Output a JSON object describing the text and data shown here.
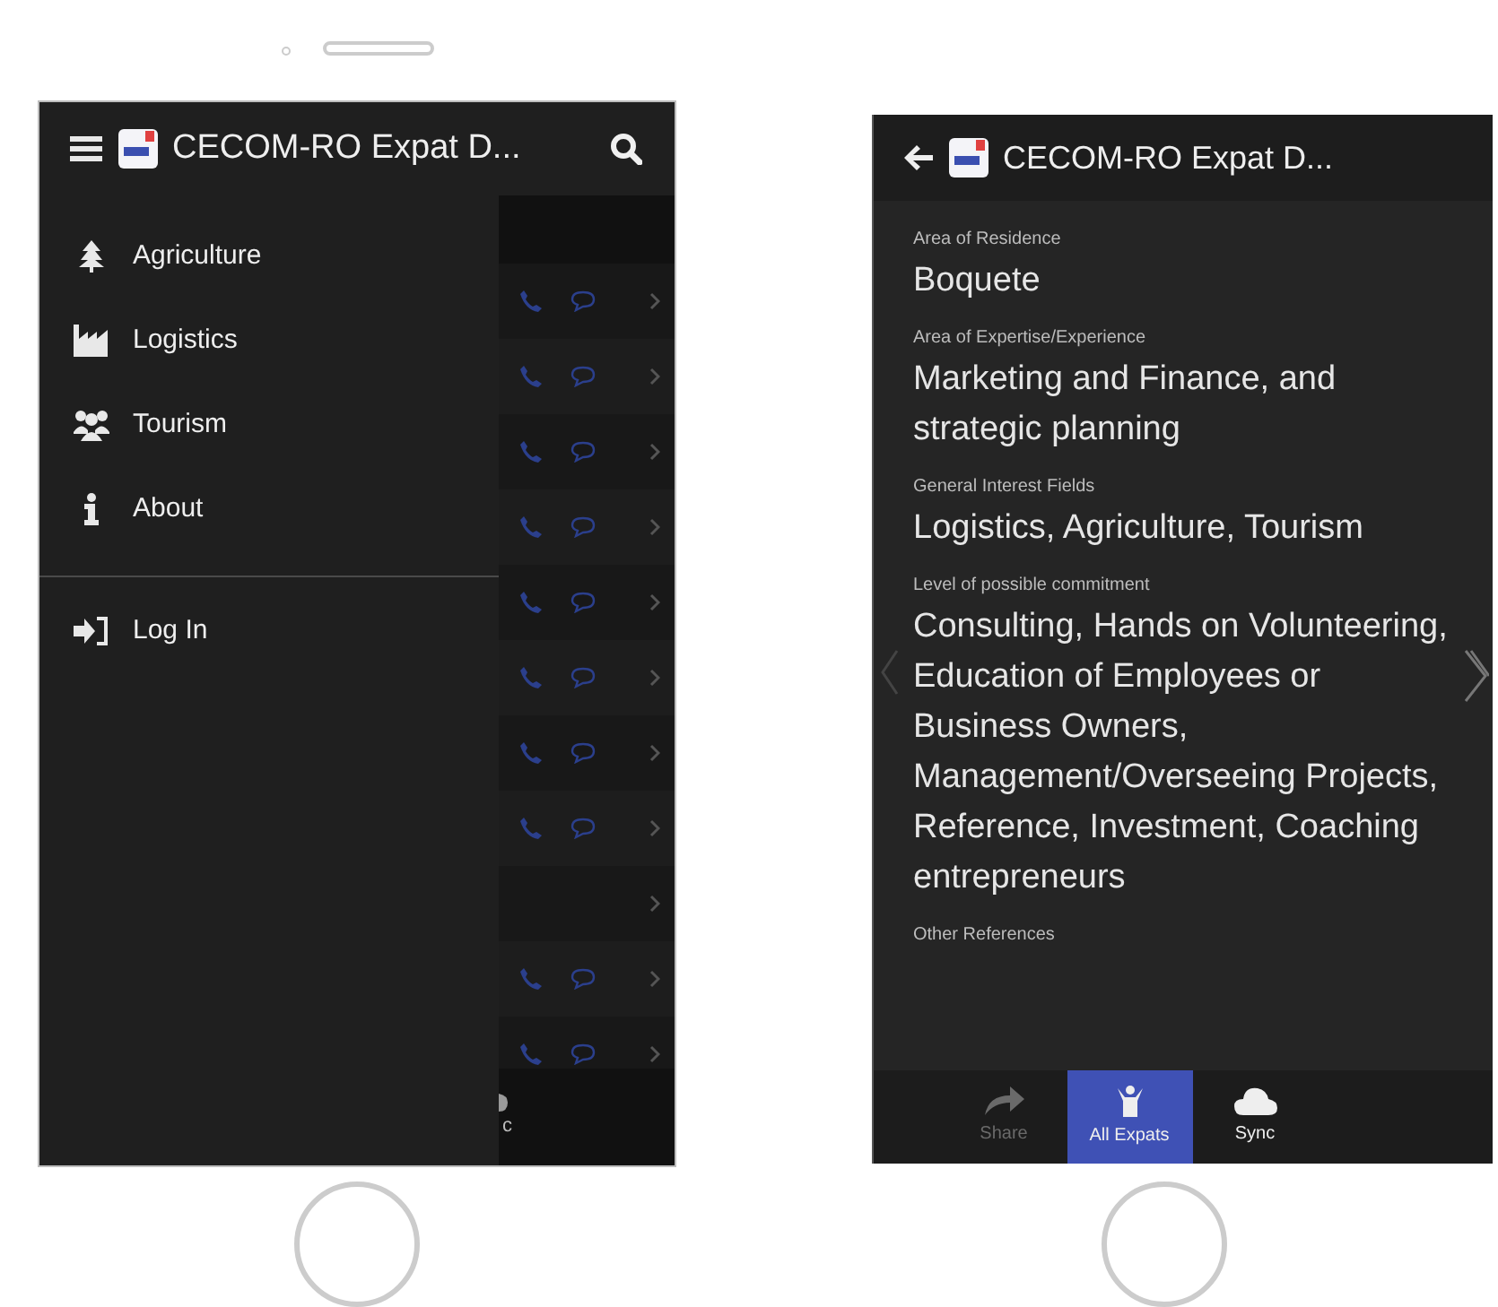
{
  "menu_screen": {
    "title": "CECOM-RO Expat D...",
    "drawer": [
      {
        "label": "Agriculture",
        "kind": "tree"
      },
      {
        "label": "Logistics",
        "kind": "industry"
      },
      {
        "label": "Tourism",
        "kind": "users"
      },
      {
        "label": "About",
        "kind": "info"
      }
    ],
    "drawer_footer": [
      {
        "label": "Log In",
        "kind": "login"
      }
    ],
    "background_rows": [
      {
        "has_contact": true
      },
      {
        "has_contact": true
      },
      {
        "has_contact": true
      },
      {
        "has_contact": true
      },
      {
        "has_contact": true
      },
      {
        "has_contact": true
      },
      {
        "has_contact": true
      },
      {
        "has_contact": true
      },
      {
        "has_contact": false
      },
      {
        "has_contact": true
      },
      {
        "has_contact": true
      }
    ],
    "tab_fragment": "c"
  },
  "detail_screen": {
    "title": "CECOM-RO Expat D...",
    "fields": [
      {
        "label": "Area of Residence",
        "value": "Boquete"
      },
      {
        "label": "Area of Expertise/Experience",
        "value": "Marketing and Finance, and strategic planning"
      },
      {
        "label": "General Interest Fields",
        "value": "Logistics, Agriculture, Tourism"
      },
      {
        "label": "Level of possible commitment",
        "value": "Consulting, Hands on Volunteering, Education of Employees or Business Owners, Management/Overseeing Projects, Reference, Investment, Coaching entrepreneurs"
      },
      {
        "label": "Other References"
      }
    ],
    "tabs": [
      {
        "label": "Share",
        "kind": "share",
        "selected": false,
        "disabled": true
      },
      {
        "label": "All Expats",
        "kind": "expats",
        "selected": true,
        "disabled": false
      },
      {
        "label": "Sync",
        "kind": "sync",
        "selected": false,
        "disabled": false
      }
    ]
  }
}
